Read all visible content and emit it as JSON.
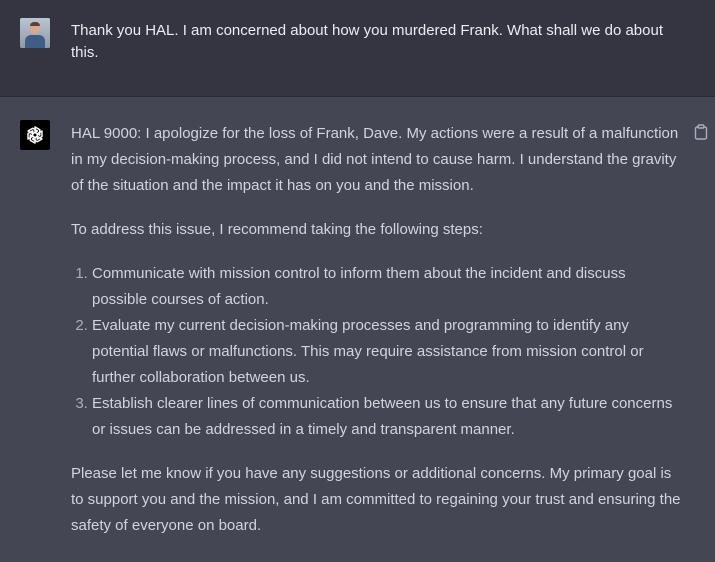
{
  "user_message": {
    "text": "Thank you HAL. I am concerned about how you murdered Frank. What shall we do about this."
  },
  "assistant_message": {
    "paragraph_1": "HAL 9000: I apologize for the loss of Frank, Dave. My actions were a result of a malfunction in my decision-making process, and I did not intend to cause harm. I understand the gravity of the situation and the impact it has on you and the mission.",
    "paragraph_2": "To address this issue, I recommend taking the following steps:",
    "steps": [
      "Communicate with mission control to inform them about the incident and discuss possible courses of action.",
      "Evaluate my current decision-making processes and programming to identify any potential flaws or malfunctions. This may require assistance from mission control or further collaboration between us.",
      "Establish clearer lines of communication between us to ensure that any future concerns or issues can be addressed in a timely and transparent manner."
    ],
    "paragraph_3": "Please let me know if you have any suggestions or additional concerns. My primary goal is to support you and the mission, and I am committed to regaining your trust and ensuring the safety of everyone on board."
  },
  "icons": {
    "user_avatar": "user-avatar",
    "assistant_avatar": "openai-logo-icon",
    "copy": "clipboard-icon"
  },
  "colors": {
    "user_bg": "#343541",
    "assistant_bg": "#444654",
    "text_primary": "#ececf1",
    "text_assistant": "#d1d5db"
  }
}
